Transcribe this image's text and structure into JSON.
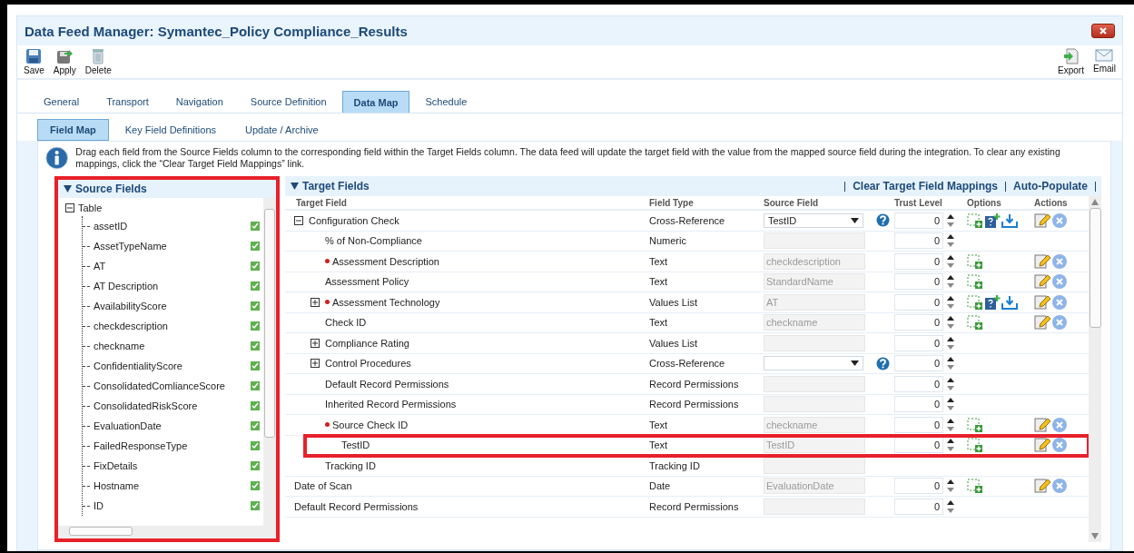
{
  "window": {
    "title": "Data Feed Manager: Symantec_Policy Compliance_Results"
  },
  "toolbar_left": [
    {
      "kind": "save",
      "label": "Save"
    },
    {
      "kind": "apply",
      "label": "Apply"
    },
    {
      "kind": "delete",
      "label": "Delete"
    }
  ],
  "toolbar_right": [
    {
      "kind": "export",
      "label": "Export"
    },
    {
      "kind": "email",
      "label": "Email"
    }
  ],
  "tabs": [
    {
      "label": "General",
      "selected": false
    },
    {
      "label": "Transport",
      "selected": false
    },
    {
      "label": "Navigation",
      "selected": false
    },
    {
      "label": "Source Definition",
      "selected": false
    },
    {
      "label": "Data Map",
      "selected": true
    },
    {
      "label": "Schedule",
      "selected": false
    }
  ],
  "subtabs": [
    {
      "label": "Field Map",
      "selected": true
    },
    {
      "label": "Key Field Definitions",
      "selected": false
    },
    {
      "label": "Update / Archive",
      "selected": false
    }
  ],
  "info": "Drag each field from the Source Fields column to the corresponding field within the Target Fields column. The data feed will update the target field with the value from the mapped source field during the integration. To clear any existing mappings, click the “Clear Target Field Mappings” link.",
  "source_fields": {
    "title": "Source Fields",
    "highlighted": true,
    "root": {
      "label": "Table",
      "expanded": true,
      "children": [
        {
          "label": "assetID",
          "checked": true
        },
        {
          "label": "AssetTypeName",
          "checked": true
        },
        {
          "label": "AT",
          "checked": true
        },
        {
          "label": "AT Description",
          "checked": true
        },
        {
          "label": "AvailabilityScore",
          "checked": true
        },
        {
          "label": "checkdescription",
          "checked": true
        },
        {
          "label": "checkname",
          "checked": true
        },
        {
          "label": "ConfidentialityScore",
          "checked": true
        },
        {
          "label": "ConsolidatedComlianceScore",
          "checked": true
        },
        {
          "label": "ConsolidatedRiskScore",
          "checked": true
        },
        {
          "label": "EvaluationDate",
          "checked": true
        },
        {
          "label": "FailedResponseType",
          "checked": true
        },
        {
          "label": "FixDetails",
          "checked": true
        },
        {
          "label": "Hostname",
          "checked": true
        },
        {
          "label": "ID",
          "checked": true
        }
      ]
    }
  },
  "target_fields": {
    "title": "Target Fields",
    "links": [
      "Clear Target Field Mappings",
      "Auto-Populate"
    ],
    "columns": [
      "Target Field",
      "Field Type",
      "Source Field",
      "Trust Level",
      "Options",
      "Actions"
    ],
    "rows": [
      {
        "label": "Configuration Check",
        "required": false,
        "expanded": true,
        "field_type": "Cross-Reference",
        "source": {
          "kind": "dropdown",
          "value": "TestID"
        },
        "help": true,
        "trust": "0",
        "options": [
          {
            "kind": "add"
          },
          {
            "kind": "values"
          },
          {
            "kind": "import"
          }
        ],
        "actions": true,
        "highlighted": false,
        "children": [
          {
            "label": "% of Non-Compliance",
            "required": false,
            "field_type": "Numeric",
            "source": {
              "kind": "text"
            },
            "help": false,
            "trust": "0",
            "actions": false,
            "highlighted": false
          },
          {
            "label": "Assessment Description",
            "required": true,
            "field_type": "Text",
            "source": {
              "kind": "text",
              "value": "checkdescription"
            },
            "help": false,
            "trust": "0",
            "options": [
              {
                "kind": "add"
              }
            ],
            "actions": true,
            "highlighted": false
          },
          {
            "label": "Assessment Policy",
            "required": false,
            "field_type": "Text",
            "source": {
              "kind": "text",
              "value": "StandardName"
            },
            "help": false,
            "trust": "0",
            "options": [
              {
                "kind": "add"
              }
            ],
            "actions": true,
            "highlighted": false
          },
          {
            "label": "Assessment Technology",
            "required": true,
            "expanded": false,
            "field_type": "Values List",
            "source": {
              "kind": "text",
              "value": "AT"
            },
            "help": false,
            "trust": "0",
            "options": [
              {
                "kind": "add"
              },
              {
                "kind": "values"
              },
              {
                "kind": "import"
              }
            ],
            "actions": true,
            "highlighted": false
          },
          {
            "label": "Check ID",
            "required": false,
            "field_type": "Text",
            "source": {
              "kind": "text",
              "value": "checkname"
            },
            "help": false,
            "trust": "0",
            "options": [
              {
                "kind": "add"
              }
            ],
            "actions": true,
            "highlighted": false
          },
          {
            "label": "Compliance Rating",
            "required": false,
            "expanded": false,
            "field_type": "Values List",
            "source": {
              "kind": "text"
            },
            "help": false,
            "trust": "0",
            "actions": false,
            "highlighted": false
          },
          {
            "label": "Control Procedures",
            "required": false,
            "expanded": false,
            "field_type": "Cross-Reference",
            "source": {
              "kind": "dropdown"
            },
            "help": true,
            "trust": "0",
            "actions": false,
            "highlighted": false
          },
          {
            "label": "Default Record Permissions",
            "required": false,
            "field_type": "Record Permissions",
            "source": {
              "kind": "text"
            },
            "help": false,
            "trust": "0",
            "actions": false,
            "highlighted": false
          },
          {
            "label": "Inherited Record Permissions",
            "required": false,
            "field_type": "Record Permissions",
            "source": {
              "kind": "text"
            },
            "help": false,
            "trust": "0",
            "actions": false,
            "highlighted": false
          },
          {
            "label": "Source Check ID",
            "required": true,
            "field_type": "Text",
            "source": {
              "kind": "text",
              "value": "checkname"
            },
            "help": false,
            "trust": "0",
            "options": [
              {
                "kind": "add"
              }
            ],
            "actions": true,
            "highlighted": false
          },
          {
            "label": "TestID",
            "required": false,
            "field_type": "Text",
            "source": {
              "kind": "text",
              "value": "TestID"
            },
            "help": false,
            "trust": "0",
            "options": [
              {
                "kind": "add"
              }
            ],
            "actions": true,
            "highlighted": true
          },
          {
            "label": "Tracking ID",
            "required": false,
            "field_type": "Tracking ID",
            "source": {
              "kind": "text"
            },
            "help": false,
            "actions": false,
            "highlighted": false
          }
        ]
      },
      {
        "label": "Date of Scan",
        "required": false,
        "field_type": "Date",
        "source": {
          "kind": "text",
          "value": "EvaluationDate"
        },
        "help": false,
        "trust": "0",
        "options": [
          {
            "kind": "add"
          }
        ],
        "actions": true,
        "highlighted": false
      },
      {
        "label": "Default Record Permissions",
        "required": false,
        "field_type": "Record Permissions",
        "source": {
          "kind": "text"
        },
        "help": false,
        "trust": "0",
        "actions": false,
        "highlighted": false
      }
    ]
  }
}
